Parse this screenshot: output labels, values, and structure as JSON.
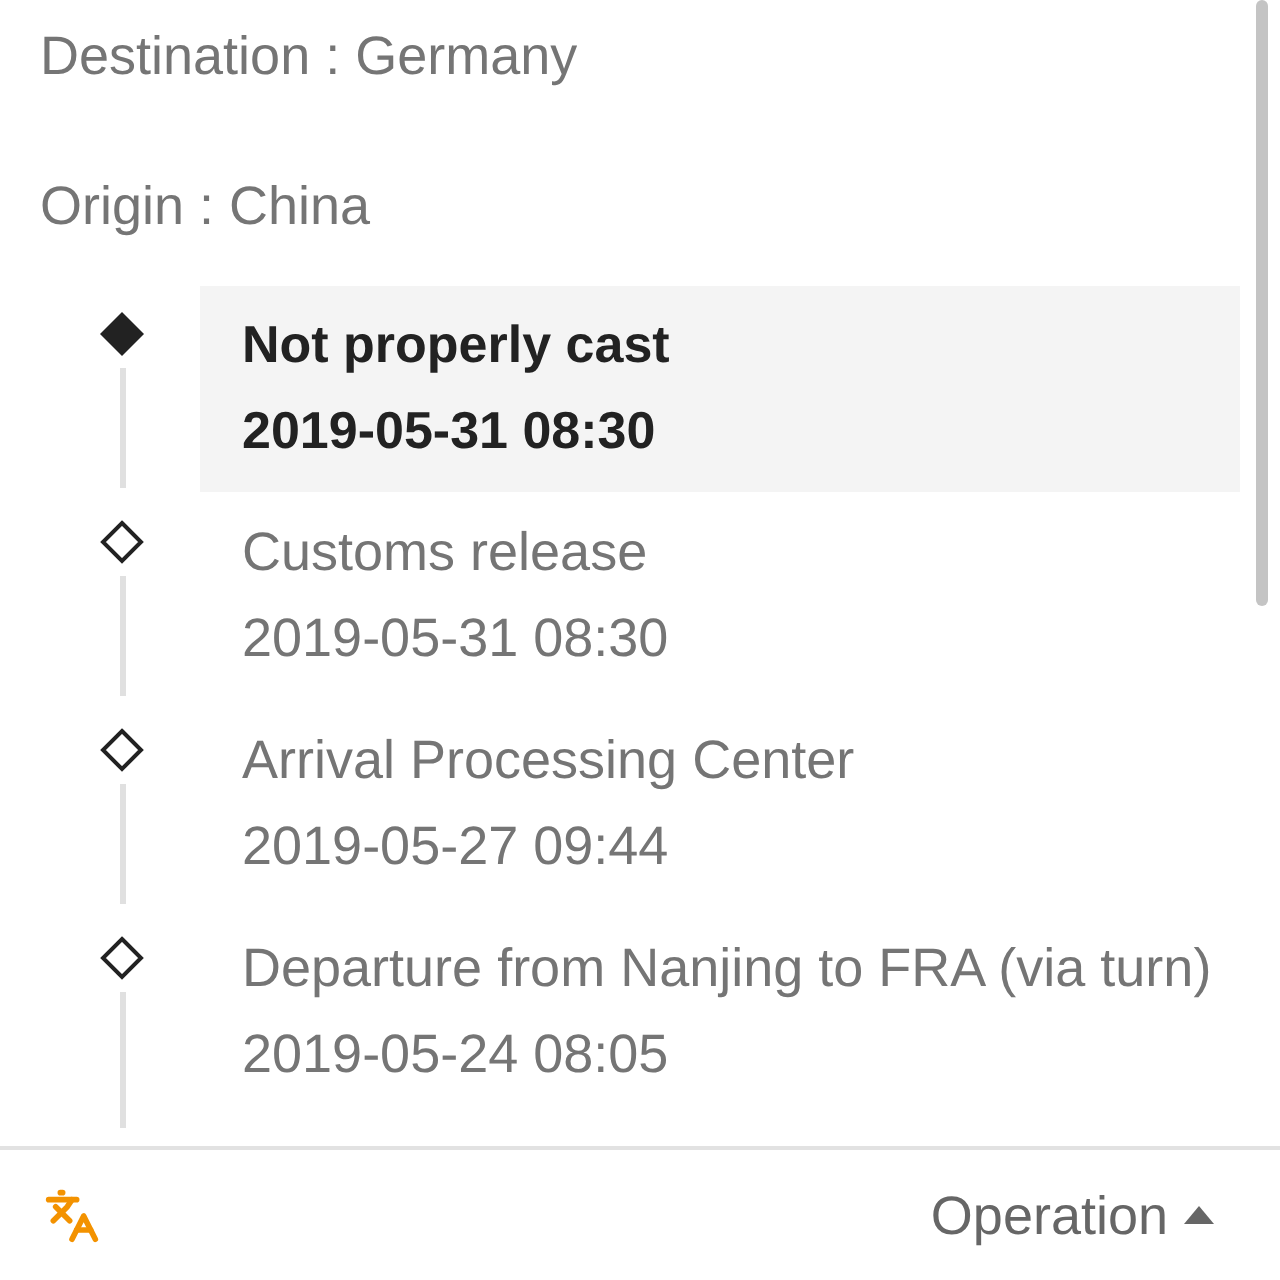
{
  "header": {
    "destination": "Destination : Germany",
    "origin": "Origin : China"
  },
  "timeline": [
    {
      "title": "Not properly cast",
      "time": "2019-05-31 08:30",
      "selected": true
    },
    {
      "title": "Customs release",
      "time": "2019-05-31 08:30",
      "selected": false
    },
    {
      "title": "Arrival Processing Center",
      "time": "2019-05-27 09:44",
      "selected": false
    },
    {
      "title": "Departure from Nanjing to FRA (via turn)",
      "time": "2019-05-24 08:05",
      "selected": false
    }
  ],
  "footer": {
    "action": "Operation"
  }
}
